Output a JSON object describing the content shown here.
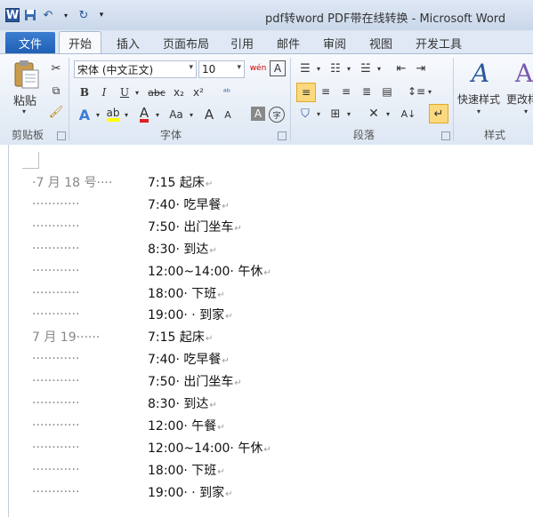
{
  "window": {
    "title": "pdf转word PDF带在线转换 - Microsoft Word"
  },
  "tabs": {
    "file": "文件",
    "items": [
      "开始",
      "插入",
      "页面布局",
      "引用",
      "邮件",
      "审阅",
      "视图",
      "开发工具"
    ]
  },
  "ribbon": {
    "clipboard": {
      "paste": "粘贴",
      "label": "剪贴板"
    },
    "font": {
      "name": "宋体 (中文正文)",
      "size": "10",
      "label": "字体",
      "bold": "B",
      "italic": "I",
      "underline": "U",
      "strike": "abc",
      "sub": "x₂",
      "sup": "x²",
      "grow": "A",
      "shrink": "A",
      "case": "Aa",
      "phonetic": "wén",
      "border_char": "A",
      "enclose": "字"
    },
    "paragraph": {
      "label": "段落"
    },
    "styles": {
      "quick": "快速样式",
      "change": "更改样",
      "label": "样式"
    }
  },
  "document": {
    "lines": [
      {
        "prefix": "·7 月 18 号····",
        "time": "7:15",
        "text": " 起床"
      },
      {
        "prefix": "············",
        "time": "7:40",
        "text": "· 吃早餐"
      },
      {
        "prefix": "············",
        "time": "7:50",
        "text": "· 出门坐车"
      },
      {
        "prefix": "············",
        "time": "8:30",
        "text": "· 到达"
      },
      {
        "prefix": "············",
        "time": "12:00~14:00",
        "text": "· 午休"
      },
      {
        "prefix": "············",
        "time": "18:00",
        "text": "· 下班"
      },
      {
        "prefix": "············",
        "time": "19:00",
        "text": "· · 到家"
      },
      {
        "prefix": "7 月 19······",
        "time": "7:15",
        "text": " 起床"
      },
      {
        "prefix": "············",
        "time": "7:40",
        "text": "· 吃早餐"
      },
      {
        "prefix": "············",
        "time": "7:50",
        "text": "· 出门坐车"
      },
      {
        "prefix": "············",
        "time": "8:30",
        "text": "· 到达"
      },
      {
        "prefix": "············",
        "time": "12:00",
        "text": "· 午餐"
      },
      {
        "prefix": "············",
        "time": "12:00~14:00",
        "text": "· 午休"
      },
      {
        "prefix": "············",
        "time": "18:00",
        "text": "· 下班"
      },
      {
        "prefix": "············",
        "time": "19:00",
        "text": "· · 到家"
      }
    ],
    "para_mark": "↵"
  },
  "colors": {
    "accent": "#2b579a",
    "file_tab": "#2a66b8",
    "highlight": "#fbd97c"
  }
}
